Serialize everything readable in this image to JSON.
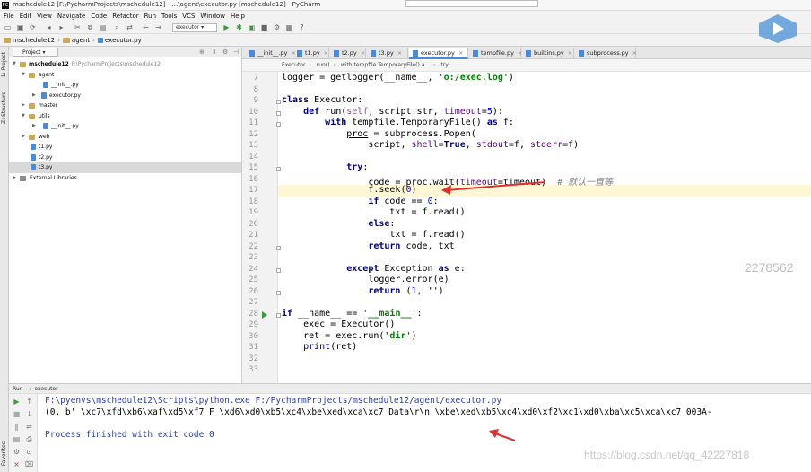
{
  "window": {
    "title": "mschedule12 [F:\\PycharmProjects\\mschedule12] - ...\\agent\\executor.py [mschedule12] - PyCharm"
  },
  "menu": [
    "File",
    "Edit",
    "View",
    "Navigate",
    "Code",
    "Refactor",
    "Run",
    "Tools",
    "VCS",
    "Window",
    "Help"
  ],
  "toolbar": {
    "run_config": "executor"
  },
  "navbar": {
    "crumbs": [
      "mschedule12",
      "agent",
      "executor.py"
    ]
  },
  "side_stripe": {
    "project": "1: Project",
    "structure": "Z: Structure",
    "favorites": "Favorites"
  },
  "project": {
    "selector": "Project",
    "root_name": "mschedule12",
    "root_path": "F:\\PycharmProjects\\mschedule12",
    "tree": [
      {
        "label": "agent",
        "type": "folder"
      },
      {
        "label": "__init__.py",
        "type": "py"
      },
      {
        "label": "executor.py",
        "type": "py"
      },
      {
        "label": "master",
        "type": "folder"
      },
      {
        "label": "utils",
        "type": "folder"
      },
      {
        "label": "__init__.py",
        "type": "py"
      },
      {
        "label": "web",
        "type": "folder"
      },
      {
        "label": "t1.py",
        "type": "py"
      },
      {
        "label": "t2.py",
        "type": "py"
      },
      {
        "label": "t3.py",
        "type": "py"
      },
      {
        "label": "External Libraries",
        "type": "lib"
      }
    ]
  },
  "tabs": [
    "__init__.py",
    "t1.py",
    "t2.py",
    "t3.py",
    "executor.py",
    "tempfile.py",
    "builtins.py",
    "subprocess.py"
  ],
  "active_tab": "executor.py",
  "breadcrumb": [
    "Executor",
    "run()",
    "with tempfile.TemporaryFile() a...",
    "try"
  ],
  "editor": {
    "line_numbers": [
      "7",
      "8",
      "9",
      "10",
      "11",
      "12",
      "13",
      "14",
      "15",
      "16",
      "17",
      "18",
      "19",
      "20",
      "21",
      "22",
      "23",
      "24",
      "25",
      "26",
      "27",
      "28",
      "29",
      "30",
      "31",
      "32",
      "33"
    ],
    "current_line": "17"
  },
  "run_panel": {
    "header": "Run",
    "config": "executor",
    "cmd": "F:\\pyenvs\\mschedule12\\Scripts\\python.exe F:/PycharmProjects/mschedule12/agent/executor.py",
    "output": "(0, b' \\xc7\\xfd\\xb6\\xaf\\xd5\\xf7 F \\xd6\\xd0\\xb5\\xc4\\xbe\\xed\\xca\\xc7 Data\\r\\n \\xbe\\xed\\xb5\\xc4\\xd0\\xf2\\xc1\\xd0\\xba\\xc5\\xca\\xc7 003A-",
    "finished": "Process finished with exit code 0"
  },
  "watermarks": {
    "number": "2278562",
    "url": "https://blog.csdn.net/qq_42227818"
  },
  "colors": {
    "keyword": "#000080",
    "string": "#008000",
    "number": "#0000ff",
    "self": "#94558d",
    "param": "#660099",
    "comment": "#808080",
    "arrow": "#e03030",
    "current_line": "#fff7d6"
  }
}
